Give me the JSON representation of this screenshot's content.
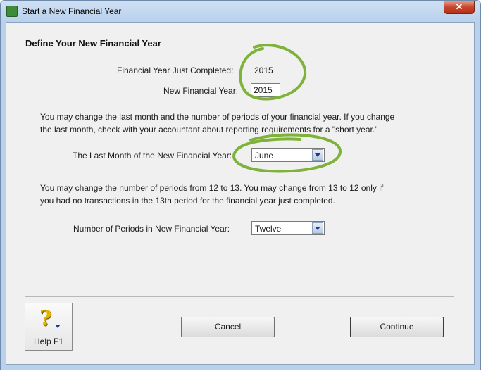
{
  "window": {
    "title": "Start a New Financial Year",
    "close_glyph": "✕"
  },
  "section": {
    "title": "Define Your New Financial Year"
  },
  "fields": {
    "year_completed_label": "Financial Year Just Completed:",
    "year_completed_value": "2015",
    "new_year_label": "New Financial Year:",
    "new_year_value": "2015",
    "last_month_label": "The Last Month of the New Financial Year:",
    "last_month_value": "June",
    "periods_label": "Number of Periods in New Financial Year:",
    "periods_value": "Twelve"
  },
  "paragraphs": {
    "month_note_line1": "You may change the last month and the number of periods of your financial year. If you change",
    "month_note_line2": "the last month, check with your accountant about reporting requirements for a \"short year.\"",
    "periods_note_line1": "You may change the number of periods from 12 to 13.  You may change from 13 to 12 only if",
    "periods_note_line2": "you had no transactions in the 13th period for the financial year just completed."
  },
  "buttons": {
    "help_label": "Help F1",
    "help_icon": "question-mark",
    "cancel_label": "Cancel",
    "continue_label": "Continue"
  },
  "colors": {
    "annotation": "#7fb23a"
  }
}
